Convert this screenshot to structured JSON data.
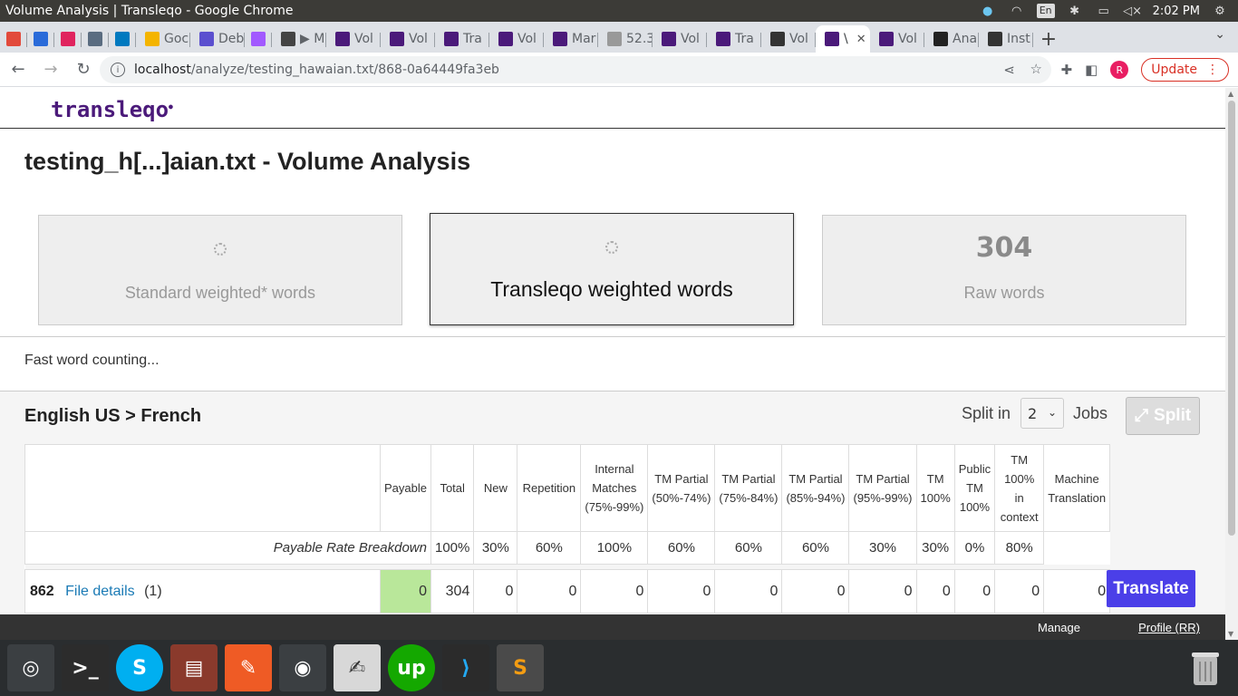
{
  "os": {
    "window_title": "Volume Analysis | Transleqo - Google Chrome",
    "lang_indicator": "En",
    "clock": "2:02 PM"
  },
  "browser": {
    "tabs": [
      {
        "label": "",
        "color": "#e24a3b",
        "icon": "gmail-icon"
      },
      {
        "label": "",
        "color": "#2a6bd9",
        "icon": "wave-icon"
      },
      {
        "label": "",
        "color": "#e0245e",
        "icon": "app-icon"
      },
      {
        "label": "",
        "color": "#5a6c80",
        "icon": "calendar-icon"
      },
      {
        "label": "",
        "color": "#0079bf",
        "icon": "trello-icon"
      },
      {
        "label": "Goc",
        "color": "#f4b400",
        "icon": "google-icon"
      },
      {
        "label": "Deb",
        "color": "#5b4fcf",
        "icon": "doc-icon"
      },
      {
        "label": "",
        "color": "#a259ff",
        "icon": "figma-icon"
      },
      {
        "label": "▶ M",
        "color": "#444444",
        "icon": "play-icon"
      },
      {
        "label": "Vol",
        "color": "#4b1a7a",
        "icon": "transleqo-icon"
      },
      {
        "label": "Vol",
        "color": "#4b1a7a",
        "icon": "transleqo-icon"
      },
      {
        "label": "Tra",
        "color": "#4b1a7a",
        "icon": "transleqo-icon"
      },
      {
        "label": "Vol",
        "color": "#4b1a7a",
        "icon": "transleqo-icon"
      },
      {
        "label": "Mar",
        "color": "#4b1a7a",
        "icon": "transleqo-icon"
      },
      {
        "label": "52.3",
        "color": "#999999",
        "icon": "globe-icon"
      },
      {
        "label": "Vol",
        "color": "#4b1a7a",
        "icon": "transleqo-icon"
      },
      {
        "label": "Tra",
        "color": "#4b1a7a",
        "icon": "transleqo-icon"
      },
      {
        "label": "Vol",
        "color": "#333333",
        "icon": "circle-icon"
      },
      {
        "label": "\\",
        "color": "#4b1a7a",
        "icon": "transleqo-icon",
        "active": true
      },
      {
        "label": "Vol",
        "color": "#4b1a7a",
        "icon": "transleqo-icon"
      },
      {
        "label": "Ana",
        "color": "#222222",
        "icon": "github-icon"
      },
      {
        "label": "Inst",
        "color": "#333333",
        "icon": "circle-icon"
      }
    ],
    "url_host": "localhost",
    "url_path": "/analyze/testing_hawaian.txt/868-0a64449fa3eb",
    "profile_initial": "R",
    "update_label": "Update"
  },
  "app": {
    "logo": "transleqo",
    "page_title": "testing_h[...]aian.txt - Volume Analysis",
    "cards": {
      "standard_label": "Standard weighted* words",
      "transleqo_label": "Transleqo weighted words",
      "raw_value": "304",
      "raw_label": "Raw words"
    },
    "status_text": "Fast word counting...",
    "language_pair": "English US > French",
    "split_in_label": "Split in",
    "split_value": "2",
    "jobs_label": "Jobs",
    "split_button": "Split",
    "columns": [
      "Payable",
      "Total",
      "New",
      "Repetition",
      "Internal Matches (75%-99%)",
      "TM Partial (50%-74%)",
      "TM Partial (75%-84%)",
      "TM Partial (85%-94%)",
      "TM Partial (95%-99%)",
      "TM 100%",
      "Public TM 100%",
      "TM 100% in context",
      "Machine Translation"
    ],
    "rate_label": "Payable Rate Breakdown",
    "rates": [
      "100%",
      "30%",
      "60%",
      "100%",
      "60%",
      "60%",
      "60%",
      "30%",
      "30%",
      "0%",
      "80%"
    ],
    "file_row": {
      "id": "862",
      "details_link": "File details",
      "count": "(1)",
      "values": [
        "0",
        "304",
        "0",
        "0",
        "0",
        "0",
        "0",
        "0",
        "0",
        "0",
        "0",
        "0",
        "0"
      ]
    },
    "translate_button": "Translate",
    "footer_manage": "Manage",
    "footer_profile": "Profile (RR)"
  },
  "dock": [
    {
      "name": "ubuntu-icon",
      "color": "#3b3f42"
    },
    {
      "name": "terminal-icon",
      "color": "#2c2c2c"
    },
    {
      "name": "skype-icon",
      "color": "#00aff0"
    },
    {
      "name": "files-icon",
      "color": "#8a3a2c"
    },
    {
      "name": "postman-icon",
      "color": "#ef5b25"
    },
    {
      "name": "chrome-icon",
      "color": "#3b3f42"
    },
    {
      "name": "text-editor-icon",
      "color": "#d8d8d8"
    },
    {
      "name": "upwork-icon",
      "color": "#14a800"
    },
    {
      "name": "vscode-icon",
      "color": "#2b2b2b"
    },
    {
      "name": "sublime-icon",
      "color": "#4a4a4a"
    }
  ]
}
